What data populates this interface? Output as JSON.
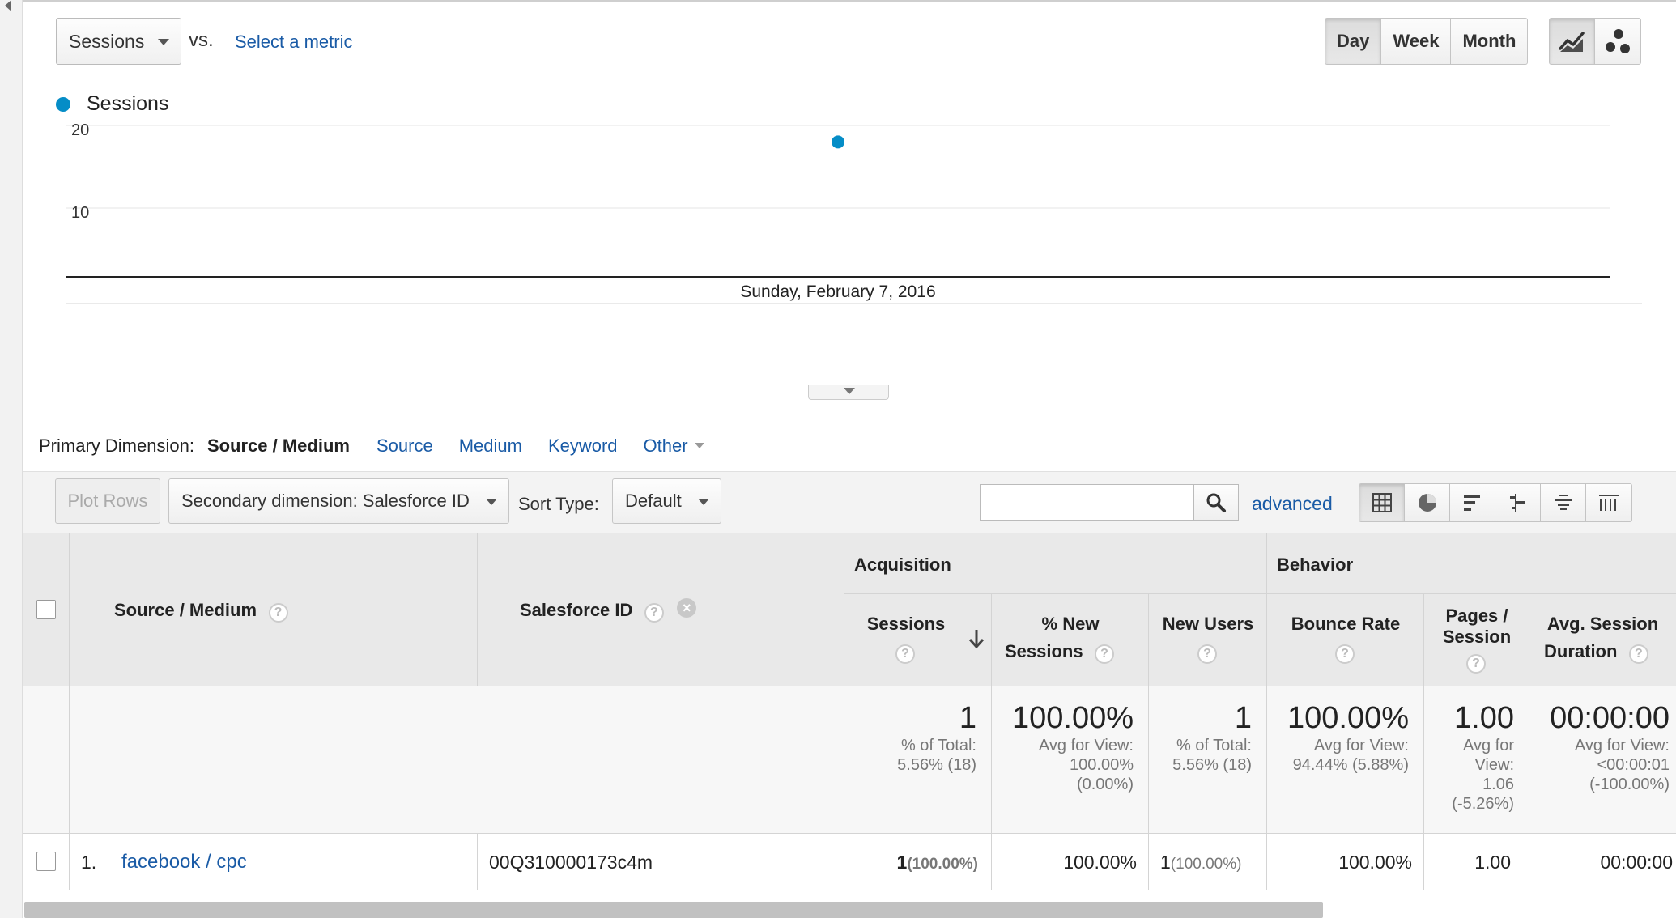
{
  "explorer": {
    "metric_select": "Sessions",
    "vs_label": "vs.",
    "select_metric": "Select a metric",
    "period_buttons": [
      "Day",
      "Week",
      "Month"
    ],
    "active_period": "Day"
  },
  "chart_data": {
    "type": "scatter",
    "series": [
      {
        "name": "Sessions",
        "color": "#058dc7",
        "x": [
          "Sunday, February 7, 2016"
        ],
        "y": [
          18
        ]
      }
    ],
    "y_ticks": [
      20,
      10
    ],
    "x_tick_labels": [
      "Sunday, February 7, 2016"
    ],
    "ylim": [
      0,
      20
    ],
    "grid": true,
    "legend": "top-left"
  },
  "primary_dimension": {
    "label": "Primary Dimension:",
    "active": "Source / Medium",
    "options": [
      "Source",
      "Medium",
      "Keyword"
    ],
    "other": "Other"
  },
  "toolbar": {
    "plot_rows": "Plot Rows",
    "secondary_dimension": "Secondary dimension: Salesforce ID",
    "sort_type_label": "Sort Type:",
    "sort_type_value": "Default",
    "search_value": "",
    "advanced": "advanced"
  },
  "table": {
    "col_source_medium": "Source / Medium",
    "col_salesforce_id": "Salesforce ID",
    "group_acquisition": "Acquisition",
    "group_behavior": "Behavior",
    "metric_cols": {
      "sessions": "Sessions",
      "new_sessions_1": "% New",
      "new_sessions_2": "Sessions",
      "new_users": "New Users",
      "bounce_rate": "Bounce Rate",
      "pages_session_1": "Pages /",
      "pages_session_2": "Session",
      "avg_session_1": "Avg. Session",
      "avg_session_2": "Duration"
    },
    "help_glyph": "?",
    "remove_glyph": "×",
    "totals": {
      "sessions": {
        "value": "1",
        "sub": [
          "% of Total:",
          "5.56% (18)"
        ]
      },
      "new_sessions": {
        "value": "100.00%",
        "sub": [
          "Avg for View:",
          "100.00%",
          "(0.00%)"
        ]
      },
      "new_users": {
        "value": "1",
        "sub": [
          "% of Total:",
          "5.56% (18)"
        ]
      },
      "bounce_rate": {
        "value": "100.00%",
        "sub": [
          "Avg for View:",
          "94.44% (5.88%)"
        ]
      },
      "pages_session": {
        "value": "1.00",
        "sub": [
          "Avg for",
          "View:",
          "1.06",
          "(-5.26%)"
        ]
      },
      "avg_session": {
        "value": "00:00:00",
        "sub": [
          "Avg for View:",
          "<00:00:01",
          "(-100.00%)"
        ]
      }
    },
    "rows": [
      {
        "index": "1.",
        "source_medium": "facebook / cpc",
        "salesforce_id": "00Q310000173c4m",
        "sessions": "1",
        "sessions_pct": "(100.00%)",
        "new_sessions": "100.00%",
        "new_users": "1",
        "new_users_pct": "(100.00%)",
        "bounce_rate": "100.00%",
        "pages_session": "1.00",
        "avg_session": "00:00:00"
      }
    ]
  }
}
